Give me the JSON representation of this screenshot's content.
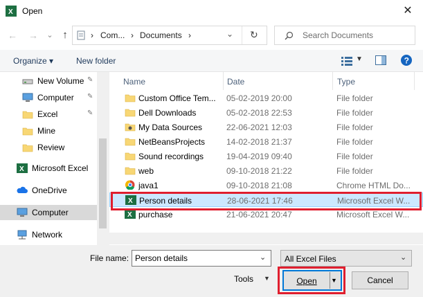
{
  "window": {
    "title": "Open",
    "close_glyph": "✕"
  },
  "navigation": {
    "back_glyph": "←",
    "forward_glyph": "→",
    "dropdown_glyph": "⌄",
    "up_glyph": "↑",
    "breadcrumb": [
      "Com...",
      "Documents"
    ],
    "sep_glyph": "›",
    "refresh_glyph": "↻",
    "search_placeholder": "Search Documents"
  },
  "toolbar": {
    "organize_label": "Organize ▾",
    "new_folder_label": "New folder",
    "help_glyph": "?"
  },
  "sidebar": {
    "items": [
      {
        "label": "New Volume",
        "icon": "drive-icon",
        "pinned": true
      },
      {
        "label": "Computer",
        "icon": "computer-icon",
        "pinned": true
      },
      {
        "label": "Excel",
        "icon": "folder-icon",
        "pinned": true
      },
      {
        "label": "Mine",
        "icon": "folder-icon",
        "pinned": false
      },
      {
        "label": "Review",
        "icon": "folder-icon",
        "pinned": false
      },
      {
        "label": "Microsoft Excel",
        "icon": "excel-icon",
        "pinned": false
      },
      {
        "label": "OneDrive",
        "icon": "cloud-icon",
        "pinned": false
      },
      {
        "label": "Computer",
        "icon": "computer-icon",
        "pinned": false
      },
      {
        "label": "Network",
        "icon": "network-icon",
        "pinned": false
      }
    ],
    "pin_glyph": "📌"
  },
  "files": {
    "columns": {
      "name": "Name",
      "date": "Date",
      "type": "Type"
    },
    "rows": [
      {
        "name": "Custom Office Tem...",
        "date": "05-02-2019 20:00",
        "type": "File folder",
        "icon": "folder-icon"
      },
      {
        "name": "Dell Downloads",
        "date": "05-02-2018 22:53",
        "type": "File folder",
        "icon": "folder-icon"
      },
      {
        "name": "My Data Sources",
        "date": "22-06-2021 12:03",
        "type": "File folder",
        "icon": "data-sources-icon"
      },
      {
        "name": "NetBeansProjects",
        "date": "14-02-2018 21:37",
        "type": "File folder",
        "icon": "folder-icon"
      },
      {
        "name": "Sound recordings",
        "date": "19-04-2019 09:40",
        "type": "File folder",
        "icon": "folder-icon"
      },
      {
        "name": "web",
        "date": "09-10-2018 21:22",
        "type": "File folder",
        "icon": "folder-icon"
      },
      {
        "name": "java1",
        "date": "09-10-2018 21:08",
        "type": "Chrome HTML Do...",
        "icon": "chrome-icon"
      },
      {
        "name": "Person details",
        "date": "28-06-2021 17:46",
        "type": "Microsoft Excel W...",
        "icon": "excel-icon"
      },
      {
        "name": "purchase",
        "date": "21-06-2021 20:47",
        "type": "Microsoft Excel W...",
        "icon": "excel-icon"
      }
    ]
  },
  "bottom": {
    "file_name_label": "File name:",
    "file_name_value": "Person details",
    "file_type_value": "All Excel Files",
    "tools_label": "Tools",
    "open_label": "Open",
    "cancel_label": "Cancel"
  },
  "colors": {
    "accent": "#0078d7",
    "highlight": "#e01e2e",
    "selection": "#cce8ff",
    "excel_green": "#1d6f42",
    "folder_yellow": "#f8d775"
  }
}
